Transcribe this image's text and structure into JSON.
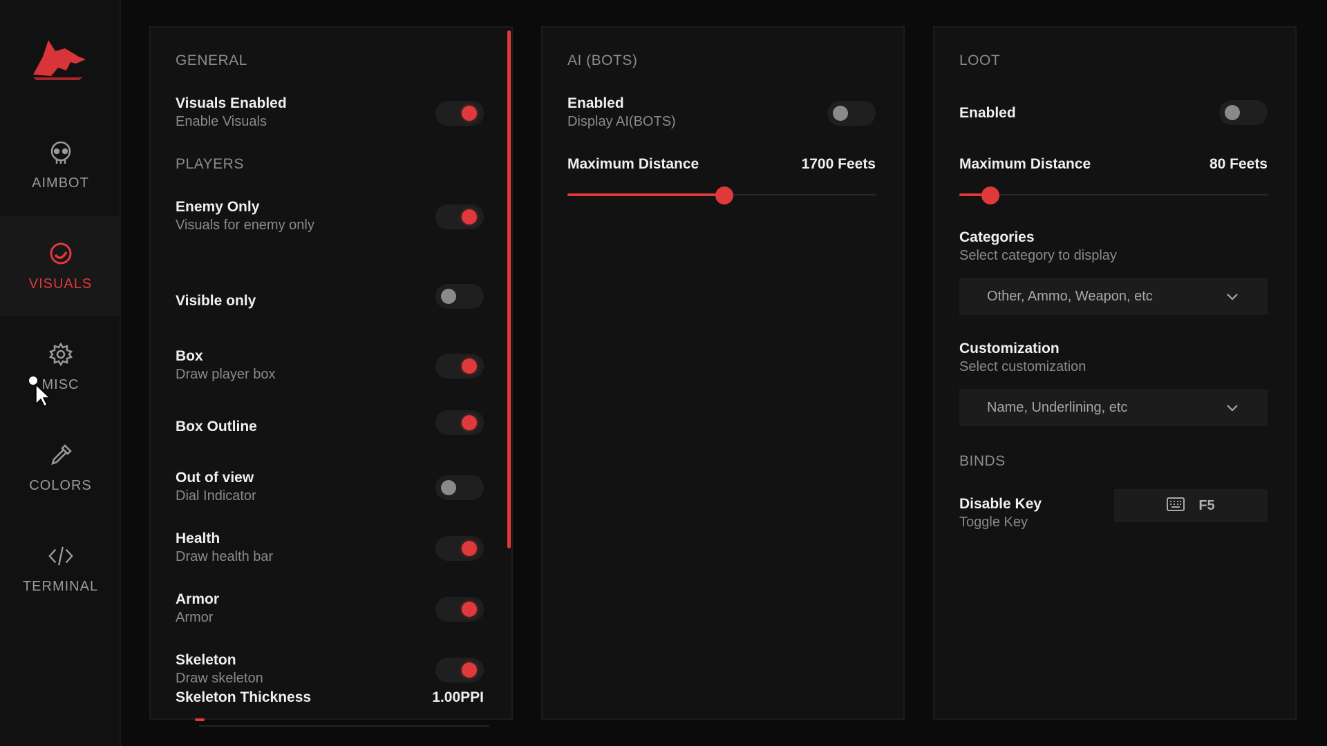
{
  "colors": {
    "accent": "#e0393b",
    "bg": "#0b0b0b",
    "panel": "#121212",
    "muted": "#8a8a8a"
  },
  "sidebar": {
    "logo_icon": "wolf-logo-icon",
    "items": [
      {
        "label": "AIMBOT",
        "icon": "skull-icon",
        "active": false
      },
      {
        "label": "VISUALS",
        "icon": "eye-icon",
        "active": true
      },
      {
        "label": "MISC",
        "icon": "gear-icon",
        "active": false
      },
      {
        "label": "COLORS",
        "icon": "pipette-icon",
        "active": false
      },
      {
        "label": "TERMINAL",
        "icon": "code-icon",
        "active": false
      }
    ]
  },
  "general": {
    "title": "GENERAL",
    "visuals_enabled": {
      "title": "Visuals Enabled",
      "subtitle": "Enable Visuals",
      "on": true
    }
  },
  "players": {
    "title": "PLAYERS",
    "rows": [
      {
        "title": "Enemy Only",
        "subtitle": "Visuals for enemy only",
        "on": true
      },
      {
        "title": "Visible only",
        "subtitle": "",
        "on": false
      },
      {
        "title": "Box",
        "subtitle": "Draw player box",
        "on": true
      },
      {
        "title": "Box Outline",
        "subtitle": "",
        "on": true
      },
      {
        "title": "Out of view",
        "subtitle": "Dial Indicator",
        "on": false
      },
      {
        "title": "Health",
        "subtitle": "Draw health bar",
        "on": true
      },
      {
        "title": "Armor",
        "subtitle": "Armor",
        "on": true
      },
      {
        "title": "Skeleton",
        "subtitle": "Draw skeleton",
        "on": true
      }
    ],
    "skeleton_thickness": {
      "label": "Skeleton Thickness",
      "value": "1.00PPI"
    }
  },
  "ai_bots": {
    "title": "AI (BOTS)",
    "enabled": {
      "title": "Enabled",
      "subtitle": "Display AI(BOTS)",
      "on": false
    },
    "max_distance": {
      "label": "Maximum Distance",
      "value": "1700 Feets",
      "fraction": 0.51
    }
  },
  "loot": {
    "title": "LOOT",
    "enabled": {
      "title": "Enabled",
      "on": false
    },
    "max_distance": {
      "label": "Maximum Distance",
      "value": "80 Feets",
      "fraction": 0.1
    },
    "categories": {
      "title": "Categories",
      "subtitle": "Select category to display",
      "selected": "Other, Ammo, Weapon, etc"
    },
    "customization": {
      "title": "Customization",
      "subtitle": "Select customization",
      "selected": "Name, Underlining, etc"
    }
  },
  "binds": {
    "title": "BINDS",
    "disable_key": {
      "title": "Disable Key",
      "subtitle": "Toggle Key",
      "key": "F5"
    }
  }
}
